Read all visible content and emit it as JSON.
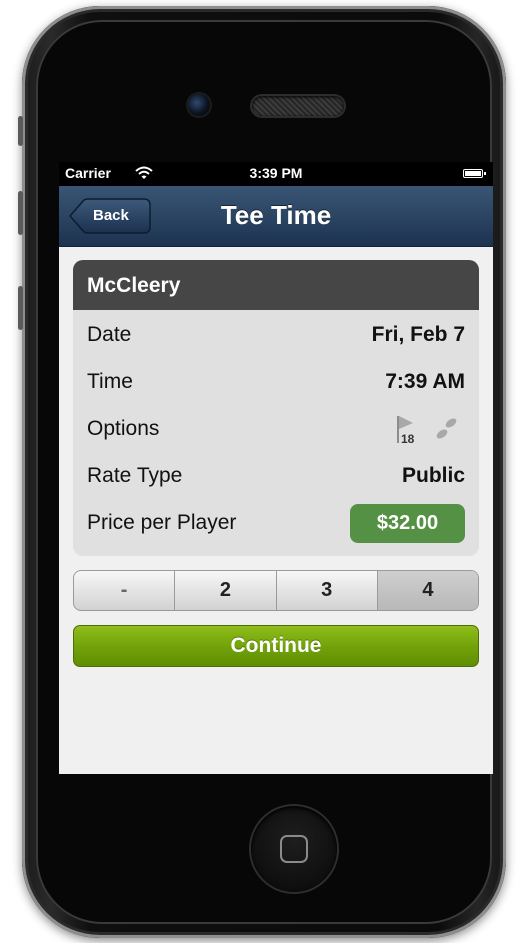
{
  "status_bar": {
    "carrier": "Carrier",
    "time": "3:39 PM"
  },
  "nav": {
    "back_label": "Back",
    "title": "Tee Time"
  },
  "course": {
    "name": "McCleery"
  },
  "details": {
    "date": {
      "label": "Date",
      "value": "Fri, Feb 7"
    },
    "time": {
      "label": "Time",
      "value": "7:39 AM"
    },
    "options": {
      "label": "Options",
      "holes": "18",
      "icons": [
        "flag-icon",
        "footprints-icon"
      ]
    },
    "rate_type": {
      "label": "Rate Type",
      "value": "Public"
    },
    "price": {
      "label": "Price per Player",
      "value": "$32.00"
    }
  },
  "players_selector": {
    "options": [
      "-",
      "2",
      "3",
      "4"
    ],
    "selected": "4"
  },
  "continue_label": "Continue",
  "colors": {
    "navbar": "#2b4563",
    "card_header": "#464646",
    "price_badge": "#559144",
    "continue_button": "#73a30a"
  }
}
